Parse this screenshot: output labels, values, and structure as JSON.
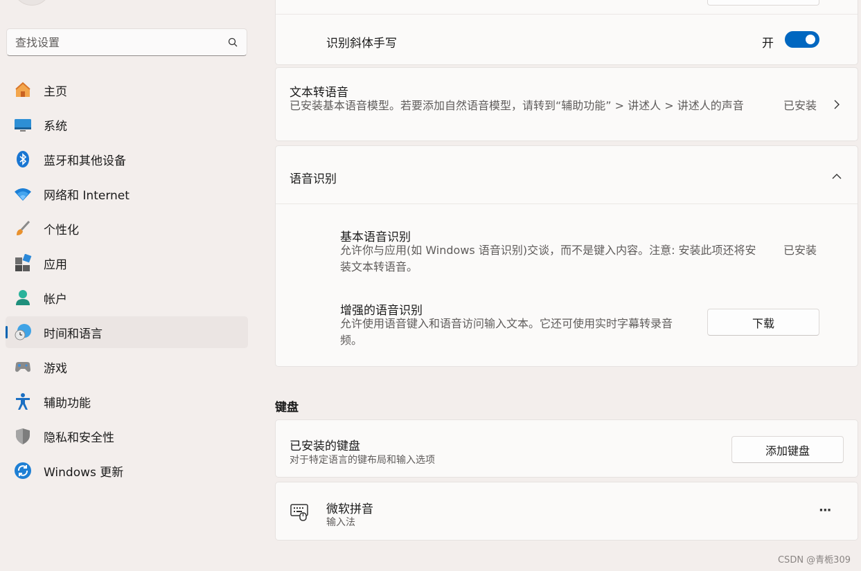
{
  "sidebar": {
    "search_placeholder": "查找设置",
    "items": [
      {
        "label": "主页",
        "icon": "home-icon"
      },
      {
        "label": "系统",
        "icon": "display-icon"
      },
      {
        "label": "蓝牙和其他设备",
        "icon": "bluetooth-icon"
      },
      {
        "label": "网络和 Internet",
        "icon": "wifi-icon"
      },
      {
        "label": "个性化",
        "icon": "brush-icon"
      },
      {
        "label": "应用",
        "icon": "apps-icon"
      },
      {
        "label": "帐户",
        "icon": "account-icon"
      },
      {
        "label": "时间和语言",
        "icon": "time-language-icon",
        "active": true
      },
      {
        "label": "游戏",
        "icon": "gamepad-icon"
      },
      {
        "label": "辅助功能",
        "icon": "accessibility-icon"
      },
      {
        "label": "隐私和安全性",
        "icon": "shield-icon"
      },
      {
        "label": "Windows 更新",
        "icon": "update-icon"
      }
    ]
  },
  "handwriting": {
    "label": "识别斜体手写",
    "toggle_state": "开",
    "on": true
  },
  "tts": {
    "title": "文本转语音",
    "desc": "已安装基本语音模型。若要添加自然语音模型，请转到“辅助功能” > 讲述人 > 讲述人的声音",
    "status": "已安装"
  },
  "speech": {
    "title": "语音识别",
    "basic": {
      "title": "基本语音识别",
      "desc": "允许你与应用(如 Windows 语音识别)交谈，而不是键入内容。注意: 安装此项还将安装文本转语音。",
      "status": "已安装"
    },
    "enhanced": {
      "title": "增强的语音识别",
      "desc": "允许使用语音键入和语音访问输入文本。它还可使用实时字幕转录音频。",
      "button": "下载"
    }
  },
  "keyboard": {
    "section_title": "键盘",
    "installed_title": "已安装的键盘",
    "installed_desc": "对于特定语言的键布局和输入选项",
    "add_button": "添加键盘",
    "ime": {
      "name": "微软拼音",
      "type": "输入法",
      "more": "···"
    }
  },
  "colors": {
    "accent": "#0067c0"
  },
  "watermark": "CSDN @青栀309"
}
